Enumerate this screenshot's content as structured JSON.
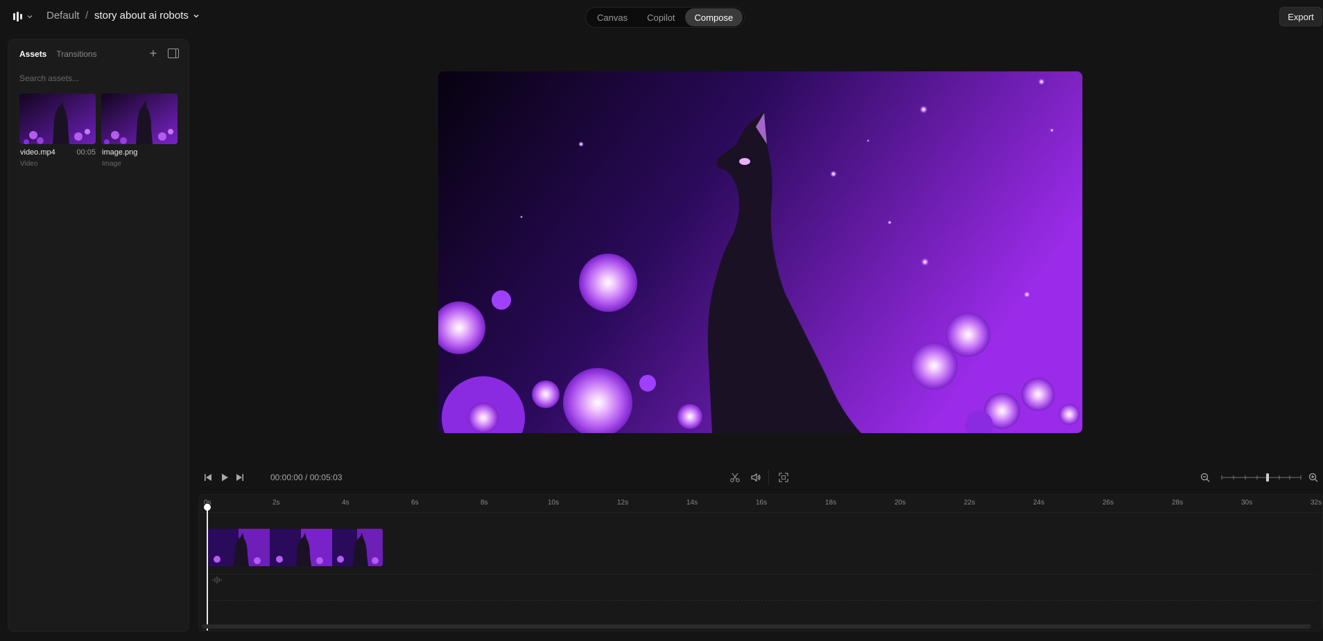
{
  "topbar": {
    "workspace": "Default",
    "separator": "/",
    "project_title": "story about ai robots",
    "modes": [
      {
        "label": "Canvas",
        "active": false
      },
      {
        "label": "Copilot",
        "active": false
      },
      {
        "label": "Compose",
        "active": true
      }
    ],
    "export_label": "Export"
  },
  "sidebar": {
    "tabs": {
      "assets": "Assets",
      "transitions": "Transitions"
    },
    "search_placeholder": "Search assets...",
    "assets": [
      {
        "name": "video.mp4",
        "duration": "00:05",
        "type": "Video"
      },
      {
        "name": "image.png",
        "duration": "",
        "type": "Image"
      }
    ]
  },
  "player": {
    "timecode": "00:00:00 / 00:05:03"
  },
  "timeline": {
    "ticks": [
      "0s",
      "2s",
      "4s",
      "6s",
      "8s",
      "10s",
      "12s",
      "14s",
      "16s",
      "18s",
      "20s",
      "22s",
      "24s",
      "26s",
      "28s",
      "30s",
      "32s"
    ]
  },
  "icons": {
    "logo": "bars-logo-icon",
    "skip_back": "skip-back-icon",
    "play": "play-icon",
    "skip_forward": "skip-forward-icon",
    "split": "scissors-icon",
    "volume": "volume-icon",
    "fullscreen": "fullscreen-icon",
    "zoom_out": "zoom-out-icon",
    "zoom_in": "zoom-in-icon"
  },
  "colors": {
    "background": "#141414",
    "panel": "#1b1b1b",
    "accent_purple": "#8a2be2"
  }
}
